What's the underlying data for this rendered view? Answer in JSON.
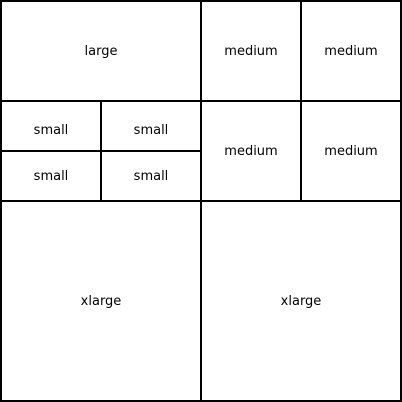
{
  "cells": {
    "large": "large",
    "medium_1": "medium",
    "medium_2": "medium",
    "medium_3": "medium",
    "medium_4": "medium",
    "small_1": "small",
    "small_2": "small",
    "small_3": "small",
    "small_4": "small",
    "xlarge_1": "xlarge",
    "xlarge_2": "xlarge"
  },
  "colors": {
    "background": "#ffffff",
    "border": "#000000",
    "text": "#000000"
  }
}
